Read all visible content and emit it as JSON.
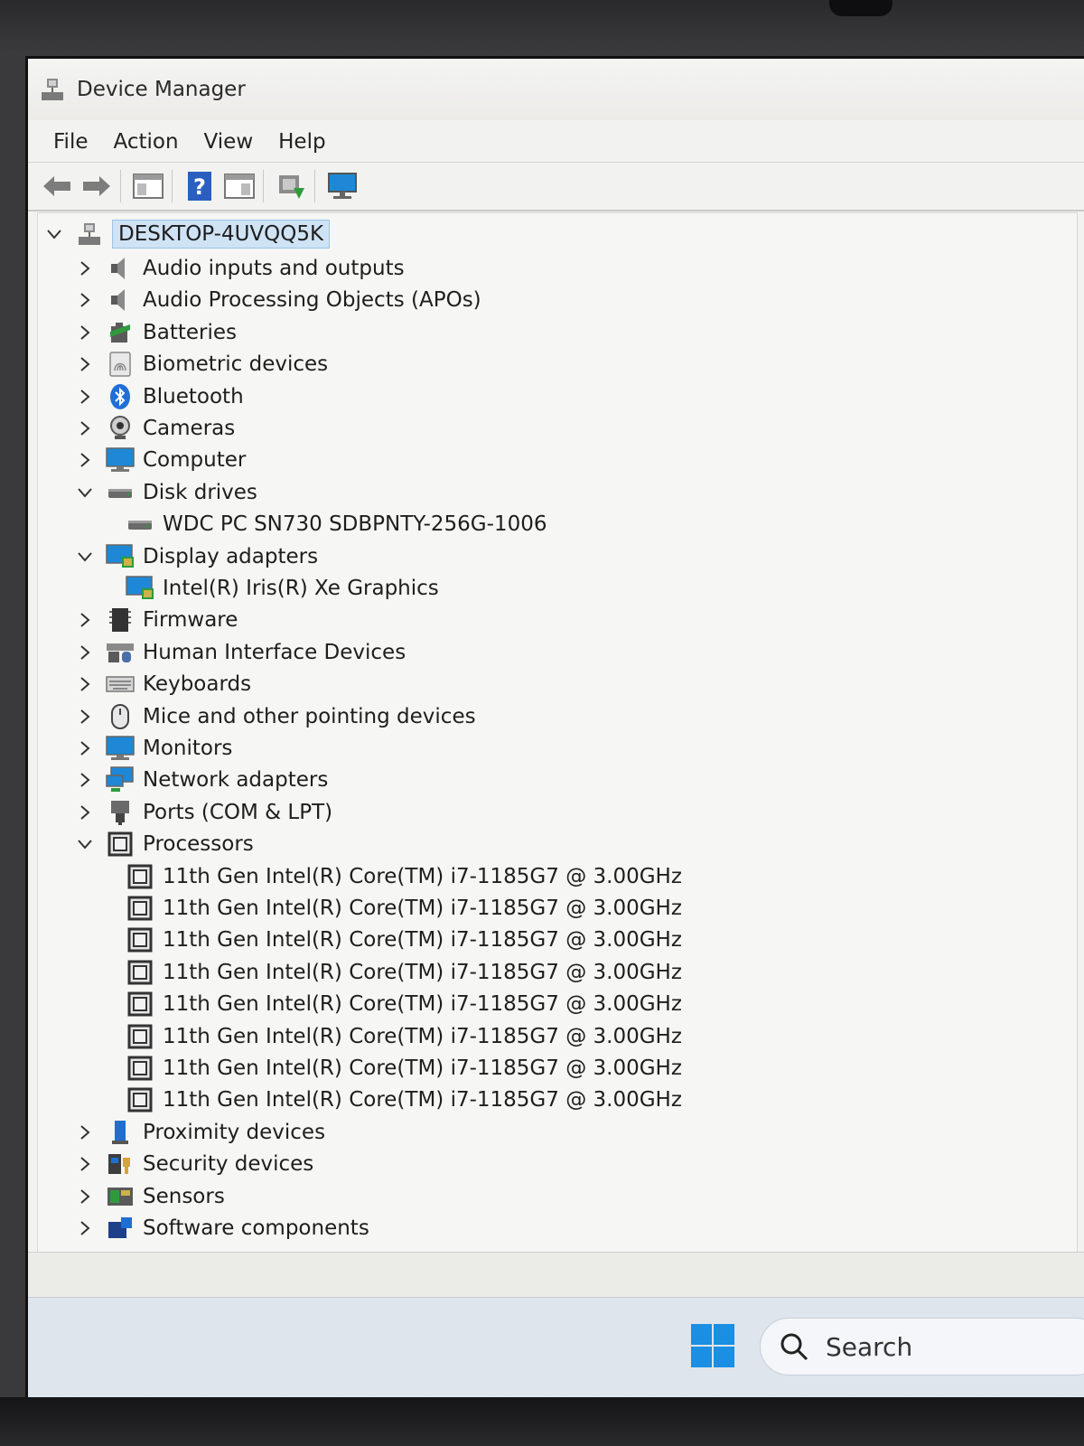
{
  "window": {
    "title": "Device Manager"
  },
  "menu": [
    "File",
    "Action",
    "View",
    "Help"
  ],
  "toolbar": {
    "buttons": [
      "back-arrow-icon",
      "forward-arrow-icon",
      "properties-panel-icon",
      "help-icon",
      "action-pane-icon",
      "update-driver-icon",
      "scan-hardware-icon"
    ]
  },
  "tree": {
    "root": "DESKTOP-4UVQQ5K",
    "items": [
      {
        "label": "Audio inputs and outputs",
        "icon": "speaker-icon",
        "expanded": false
      },
      {
        "label": "Audio Processing Objects (APOs)",
        "icon": "speaker-icon",
        "expanded": false
      },
      {
        "label": "Batteries",
        "icon": "battery-icon",
        "expanded": false
      },
      {
        "label": "Biometric devices",
        "icon": "fingerprint-icon",
        "expanded": false
      },
      {
        "label": "Bluetooth",
        "icon": "bluetooth-icon",
        "expanded": false
      },
      {
        "label": "Cameras",
        "icon": "camera-icon",
        "expanded": false
      },
      {
        "label": "Computer",
        "icon": "monitor-icon",
        "expanded": false
      },
      {
        "label": "Disk drives",
        "icon": "disk-icon",
        "expanded": true
      },
      {
        "label": "WDC PC SN730 SDBPNTY-256G-1006",
        "icon": "disk-icon",
        "child": true
      },
      {
        "label": "Display adapters",
        "icon": "display-adapter-icon",
        "expanded": true
      },
      {
        "label": "Intel(R) Iris(R) Xe Graphics",
        "icon": "display-adapter-icon",
        "child": true
      },
      {
        "label": "Firmware",
        "icon": "firmware-icon",
        "expanded": false
      },
      {
        "label": "Human Interface Devices",
        "icon": "hid-icon",
        "expanded": false
      },
      {
        "label": "Keyboards",
        "icon": "keyboard-icon",
        "expanded": false
      },
      {
        "label": "Mice and other pointing devices",
        "icon": "mouse-icon",
        "expanded": false
      },
      {
        "label": "Monitors",
        "icon": "monitor-icon",
        "expanded": false
      },
      {
        "label": "Network adapters",
        "icon": "network-icon",
        "expanded": false
      },
      {
        "label": "Ports (COM & LPT)",
        "icon": "port-icon",
        "expanded": false
      },
      {
        "label": "Processors",
        "icon": "processor-icon",
        "expanded": true
      },
      {
        "label": "11th Gen Intel(R) Core(TM) i7-1185G7 @ 3.00GHz",
        "icon": "processor-icon",
        "child": true
      },
      {
        "label": "11th Gen Intel(R) Core(TM) i7-1185G7 @ 3.00GHz",
        "icon": "processor-icon",
        "child": true
      },
      {
        "label": "11th Gen Intel(R) Core(TM) i7-1185G7 @ 3.00GHz",
        "icon": "processor-icon",
        "child": true
      },
      {
        "label": "11th Gen Intel(R) Core(TM) i7-1185G7 @ 3.00GHz",
        "icon": "processor-icon",
        "child": true
      },
      {
        "label": "11th Gen Intel(R) Core(TM) i7-1185G7 @ 3.00GHz",
        "icon": "processor-icon",
        "child": true
      },
      {
        "label": "11th Gen Intel(R) Core(TM) i7-1185G7 @ 3.00GHz",
        "icon": "processor-icon",
        "child": true
      },
      {
        "label": "11th Gen Intel(R) Core(TM) i7-1185G7 @ 3.00GHz",
        "icon": "processor-icon",
        "child": true
      },
      {
        "label": "11th Gen Intel(R) Core(TM) i7-1185G7 @ 3.00GHz",
        "icon": "processor-icon",
        "child": true
      },
      {
        "label": "Proximity devices",
        "icon": "proximity-icon",
        "expanded": false
      },
      {
        "label": "Security devices",
        "icon": "security-icon",
        "expanded": false
      },
      {
        "label": "Sensors",
        "icon": "sensor-icon",
        "expanded": false
      },
      {
        "label": "Software components",
        "icon": "software-component-icon",
        "expanded": false
      }
    ]
  },
  "taskbar": {
    "search_label": "Search"
  },
  "colors": {
    "selection": "#cfe3f5",
    "bluetooth": "#1f6fd6",
    "monitor": "#1e88d6",
    "windows_logo": "#1a8fe3"
  }
}
